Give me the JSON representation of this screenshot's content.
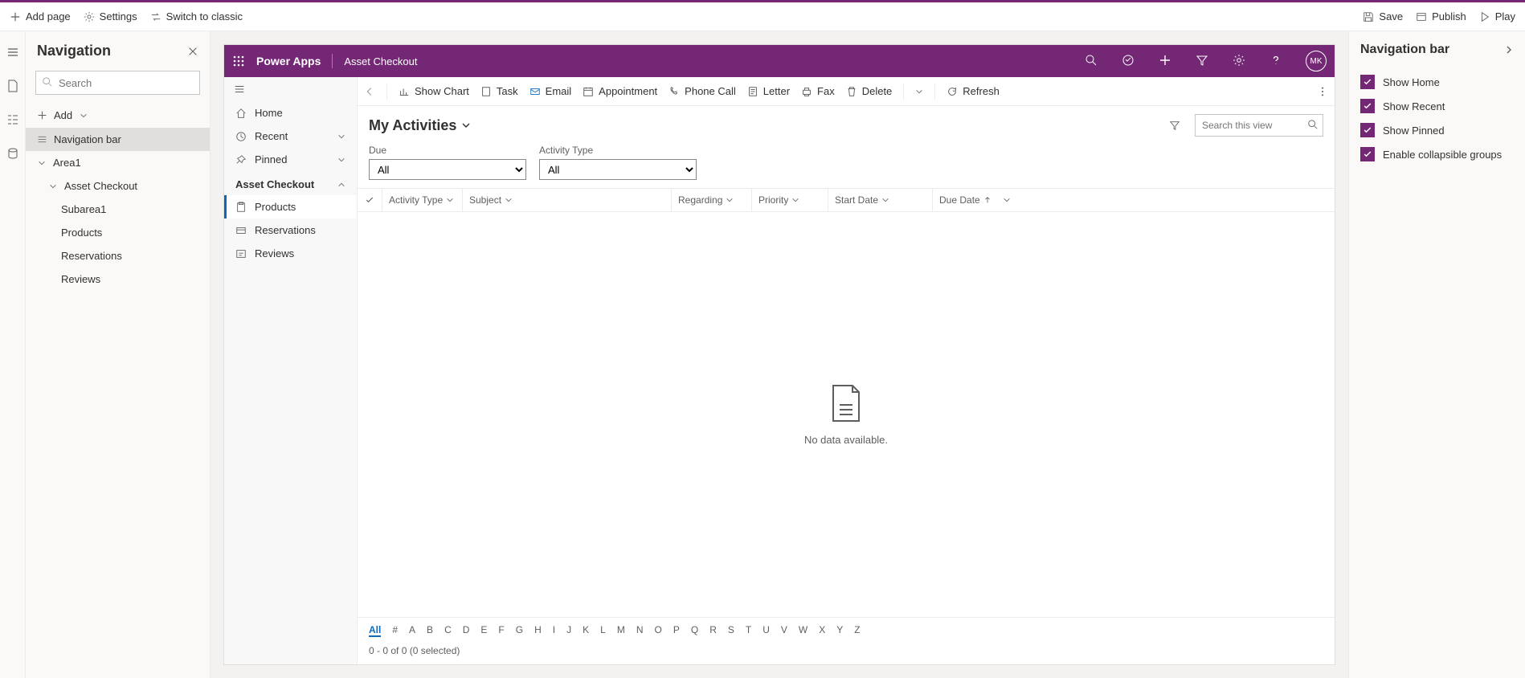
{
  "toolbar": {
    "add_page": "Add page",
    "settings": "Settings",
    "switch": "Switch to classic",
    "save": "Save",
    "publish": "Publish",
    "play": "Play"
  },
  "nav_panel": {
    "title": "Navigation",
    "search_placeholder": "Search",
    "add": "Add",
    "items": {
      "nav_bar": "Navigation bar",
      "area1": "Area1",
      "asset_checkout": "Asset Checkout",
      "subarea1": "Subarea1",
      "products": "Products",
      "reservations": "Reservations",
      "reviews": "Reviews"
    }
  },
  "app_header": {
    "brand": "Power Apps",
    "app_name": "Asset Checkout",
    "avatar": "MK"
  },
  "sidebar": {
    "home": "Home",
    "recent": "Recent",
    "pinned": "Pinned",
    "group": "Asset Checkout",
    "products": "Products",
    "reservations": "Reservations",
    "reviews": "Reviews"
  },
  "cmdbar": {
    "show_chart": "Show Chart",
    "task": "Task",
    "email": "Email",
    "appointment": "Appointment",
    "phone": "Phone Call",
    "letter": "Letter",
    "fax": "Fax",
    "delete": "Delete",
    "refresh": "Refresh"
  },
  "view": {
    "title": "My Activities",
    "search_placeholder": "Search this view",
    "due_label": "Due",
    "due_value": "All",
    "activity_type_label": "Activity Type",
    "activity_type_value": "All"
  },
  "columns": {
    "activity_type": "Activity Type",
    "subject": "Subject",
    "regarding": "Regarding",
    "priority": "Priority",
    "start_date": "Start Date",
    "due_date": "Due Date"
  },
  "empty": "No data available.",
  "alpha": [
    "All",
    "#",
    "A",
    "B",
    "C",
    "D",
    "E",
    "F",
    "G",
    "H",
    "I",
    "J",
    "K",
    "L",
    "M",
    "N",
    "O",
    "P",
    "Q",
    "R",
    "S",
    "T",
    "U",
    "V",
    "W",
    "X",
    "Y",
    "Z"
  ],
  "status": "0 - 0 of 0 (0 selected)",
  "right_panel": {
    "title": "Navigation bar",
    "show_home": "Show Home",
    "show_recent": "Show Recent",
    "show_pinned": "Show Pinned",
    "enable_collapsible": "Enable collapsible groups"
  }
}
